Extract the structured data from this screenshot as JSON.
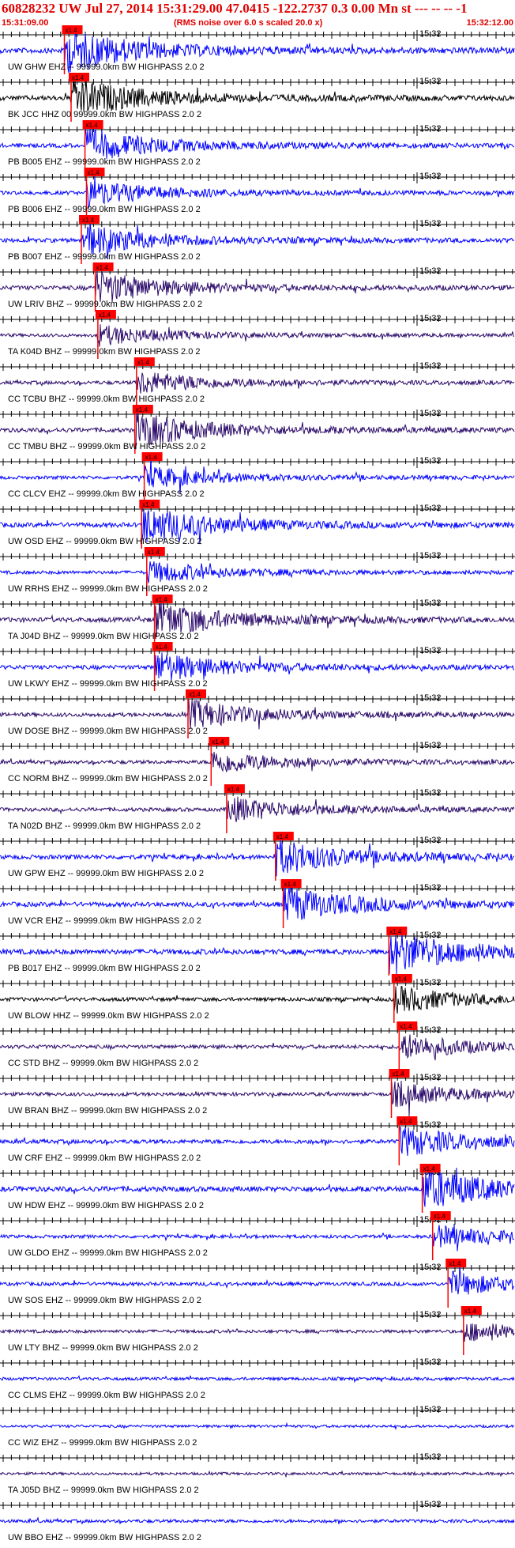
{
  "header": {
    "title": "60828232 UW Jul 27, 2014 15:31:29.00   47.0415 -122.2737  0.3 0.00 Mn st --- -- --  -1",
    "start_time": "15:31:09.00",
    "rms_note": "(RMS noise over 6.0 s scaled 20.0 x)",
    "end_time": "15:32:12.00"
  },
  "colors": {
    "header_red": "#e00000",
    "pick_red": "#ff0000",
    "trace_blue": "#0000ff",
    "trace_navy": "#2b0a6a",
    "trace_black": "#000000",
    "axis_black": "#000000"
  },
  "chart_data": {
    "type": "line",
    "time_range": [
      "15:31:09.00",
      "15:32:12.00"
    ],
    "minute_mark_label": "15:32",
    "pick_label": "x1.4",
    "traces": [
      {
        "label": "UW GHW EHZ -- 99999.0km BW  HIGHPASS  2.0  2",
        "color": "blue",
        "pick": 0.125,
        "amp": 1.0
      },
      {
        "label": "BK JCC HHZ 00 99999.0km BW  HIGHPASS  2.0  2",
        "color": "black",
        "pick": 0.138,
        "amp": 0.9
      },
      {
        "label": "PB B005 EHZ -- 99999.0km BW  HIGHPASS  2.0  2",
        "color": "blue",
        "pick": 0.165,
        "amp": 0.75
      },
      {
        "label": "PB B006 EHZ -- 99999.0km BW  HIGHPASS  2.0  2",
        "color": "blue",
        "pick": 0.168,
        "amp": 0.6
      },
      {
        "label": "PB B007 EHZ -- 99999.0km BW  HIGHPASS  2.0  2",
        "color": "blue",
        "pick": 0.158,
        "amp": 0.7
      },
      {
        "label": "UW LRIV BHZ -- 99999.0km BW  HIGHPASS  2.0  2",
        "color": "navy",
        "pick": 0.185,
        "amp": 0.75
      },
      {
        "label": "TA K04D BHZ -- 99999.0km BW  HIGHPASS  2.0  2",
        "color": "navy",
        "pick": 0.19,
        "amp": 0.45
      },
      {
        "label": "CC TCBU BHZ -- 99999.0km BW  HIGHPASS  2.0  2",
        "color": "navy",
        "pick": 0.265,
        "amp": 0.55
      },
      {
        "label": "CC TMBU BHZ -- 99999.0km BW  HIGHPASS  2.0  2",
        "color": "navy",
        "pick": 0.262,
        "amp": 0.8
      },
      {
        "label": "CC CLCV EHZ -- 99999.0km BW  HIGHPASS  2.0  2",
        "color": "blue",
        "pick": 0.28,
        "amp": 0.5
      },
      {
        "label": "UW OSD EHZ -- 99999.0km BW  HIGHPASS  2.0  2",
        "color": "blue",
        "pick": 0.275,
        "amp": 0.85
      },
      {
        "label": "UW RRHS EHZ -- 99999.0km BW  HIGHPASS  2.0  2",
        "color": "blue",
        "pick": 0.285,
        "amp": 0.5
      },
      {
        "label": "TA J04D BHZ -- 99999.0km BW  HIGHPASS  2.0  2",
        "color": "navy",
        "pick": 0.3,
        "amp": 0.85
      },
      {
        "label": "UW LKWY EHZ -- 99999.0km BW  HIGHPASS  2.0  2",
        "color": "blue",
        "pick": 0.3,
        "amp": 0.7
      },
      {
        "label": "UW DOSE BHZ -- 99999.0km BW  HIGHPASS  2.0  2",
        "color": "navy",
        "pick": 0.365,
        "amp": 0.65
      },
      {
        "label": "CC NORM BHZ -- 99999.0km BW  HIGHPASS  2.0  2",
        "color": "navy",
        "pick": 0.41,
        "amp": 0.55
      },
      {
        "label": "TA N02D BHZ -- 99999.0km BW  HIGHPASS  2.0  2",
        "color": "navy",
        "pick": 0.44,
        "amp": 0.6
      },
      {
        "label": "UW GPW EHZ -- 99999.0km BW  HIGHPASS  2.0  2",
        "color": "blue",
        "pick": 0.535,
        "amp": 0.8
      },
      {
        "label": "UW VCR EHZ -- 99999.0km BW  HIGHPASS  2.0  2",
        "color": "blue",
        "pick": 0.55,
        "amp": 0.85
      },
      {
        "label": "PB B017 EHZ -- 99999.0km BW  HIGHPASS  2.0  2",
        "color": "blue",
        "pick": 0.755,
        "amp": 1.0
      },
      {
        "label": "UW BLOW HHZ -- 99999.0km BW  HIGHPASS  2.0  2",
        "color": "black",
        "pick": 0.765,
        "amp": 0.6
      },
      {
        "label": "CC STD BHZ -- 99999.0km BW  HIGHPASS  2.0  2",
        "color": "navy",
        "pick": 0.775,
        "amp": 0.6
      },
      {
        "label": "UW BRAN BHZ -- 99999.0km BW  HIGHPASS  2.0  2",
        "color": "navy",
        "pick": 0.76,
        "amp": 0.55
      },
      {
        "label": "UW CRF EHZ -- 99999.0km BW  HIGHPASS  2.0  2",
        "color": "blue",
        "pick": 0.775,
        "amp": 0.7
      },
      {
        "label": "UW HDW EHZ -- 99999.0km BW  HIGHPASS  2.0  2",
        "color": "blue",
        "pick": 0.82,
        "amp": 1.0
      },
      {
        "label": "UW GLDO EHZ -- 99999.0km BW  HIGHPASS  2.0  2",
        "color": "blue",
        "pick": 0.84,
        "amp": 0.5
      },
      {
        "label": "UW SOS EHZ -- 99999.0km BW  HIGHPASS  2.0  2",
        "color": "blue",
        "pick": 0.87,
        "amp": 0.55
      },
      {
        "label": "UW LTY BHZ -- 99999.0km BW  HIGHPASS  2.0  2",
        "color": "navy",
        "pick": 0.9,
        "amp": 0.45
      },
      {
        "label": "CC CLMS EHZ -- 99999.0km BW  HIGHPASS  2.0  2",
        "color": "blue",
        "pick": null,
        "amp": 0.4
      },
      {
        "label": "CC WIZ EHZ -- 99999.0km BW  HIGHPASS  2.0  2",
        "color": "blue",
        "pick": null,
        "amp": 0.3
      },
      {
        "label": "TA J05D BHZ -- 99999.0km BW  HIGHPASS  2.0  2",
        "color": "navy",
        "pick": null,
        "amp": 0.3
      },
      {
        "label": "UW BBO EHZ -- 99999.0km BW  HIGHPASS  2.0  2",
        "color": "blue",
        "pick": null,
        "amp": 0.45
      }
    ]
  }
}
